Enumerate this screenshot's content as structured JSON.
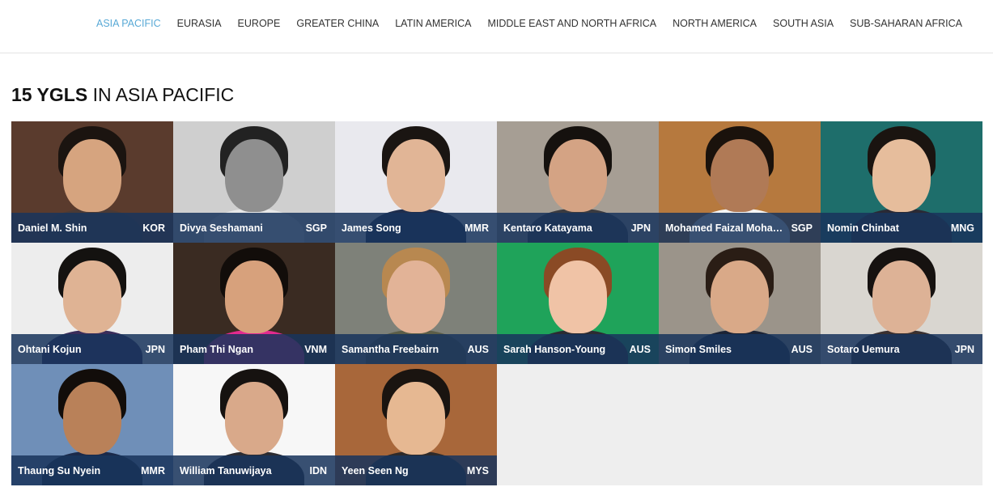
{
  "nav": {
    "items": [
      {
        "label": "ASIA PACIFIC",
        "active": true
      },
      {
        "label": "EURASIA",
        "active": false
      },
      {
        "label": "EUROPE",
        "active": false
      },
      {
        "label": "GREATER CHINA",
        "active": false
      },
      {
        "label": "LATIN AMERICA",
        "active": false
      },
      {
        "label": "MIDDLE EAST AND NORTH AFRICA",
        "active": false
      },
      {
        "label": "NORTH AMERICA",
        "active": false
      },
      {
        "label": "SOUTH ASIA",
        "active": false
      },
      {
        "label": "SUB-SAHARAN AFRICA",
        "active": false
      }
    ]
  },
  "heading": {
    "count": "15 YGLS",
    "rest": " IN ASIA PACIFIC"
  },
  "colors": {
    "nav_active": "#58a9d6",
    "caption_bg": "#18345c"
  },
  "people": [
    {
      "name": "Daniel M. Shin",
      "code": "KOR",
      "bg": "#5a3b2d",
      "skin": "#d6a47f",
      "hair": "#1b1410",
      "body": "#4b3a35"
    },
    {
      "name": "Divya Seshamani",
      "code": "SGP",
      "bg": "#cfcfcf",
      "skin": "#8f8f8f",
      "hair": "#222222",
      "body": "#e8e8e8"
    },
    {
      "name": "James Song",
      "code": "MMR",
      "bg": "#e9e9ee",
      "skin": "#e1b596",
      "hair": "#1a1512",
      "body": "#1f2e4d"
    },
    {
      "name": "Kentaro Katayama",
      "code": "JPN",
      "bg": "#a69e94",
      "skin": "#d4a384",
      "hair": "#15110e",
      "body": "#3b3b40"
    },
    {
      "name": "Mohamed Faizal Mohamed Abdul Kadir",
      "code": "SGP",
      "bg": "#b6793e",
      "skin": "#b07a56",
      "hair": "#1a120c",
      "body": "#f4f4f4"
    },
    {
      "name": "Nomin Chinbat",
      "code": "MNG",
      "bg": "#1e6e6b",
      "skin": "#e6bd9c",
      "hair": "#1a1410",
      "body": "#2a2a35"
    },
    {
      "name": "Ohtani Kojun",
      "code": "JPN",
      "bg": "#ededed",
      "skin": "#dfb394",
      "hair": "#141210",
      "body": "#3a2d5a"
    },
    {
      "name": "Pham Thi Ngan",
      "code": "VNM",
      "bg": "#3a2b22",
      "skin": "#d7a17c",
      "hair": "#120d0a",
      "body": "#e22b8e"
    },
    {
      "name": "Samantha Freebairn",
      "code": "AUS",
      "bg": "#7e8179",
      "skin": "#e2b397",
      "hair": "#b88850",
      "body": "#5c5e48"
    },
    {
      "name": "Sarah Hanson-Young",
      "code": "AUS",
      "bg": "#1fa35a",
      "skin": "#f0c3a6",
      "hair": "#8a4a25",
      "body": "#2b2b32"
    },
    {
      "name": "Simon Smiles",
      "code": "AUS",
      "bg": "#9b948a",
      "skin": "#d9a988",
      "hair": "#2a1d15",
      "body": "#1c2436"
    },
    {
      "name": "Sotaro Uemura",
      "code": "JPN",
      "bg": "#d9d6d0",
      "skin": "#ddb296",
      "hair": "#161210",
      "body": "#3a3030"
    },
    {
      "name": "Thaung Su Nyein",
      "code": "MMR",
      "bg": "#6f8fb8",
      "skin": "#b98159",
      "hair": "#120d0a",
      "body": "#1b2a4a"
    },
    {
      "name": "William Tanuwijaya",
      "code": "IDN",
      "bg": "#f7f7f7",
      "skin": "#d9a98a",
      "hair": "#161210",
      "body": "#2c2c32"
    },
    {
      "name": "Yeen Seen Ng",
      "code": "MYS",
      "bg": "#a8673a",
      "skin": "#e6b892",
      "hair": "#1a1410",
      "body": "#2e2a2a"
    }
  ]
}
